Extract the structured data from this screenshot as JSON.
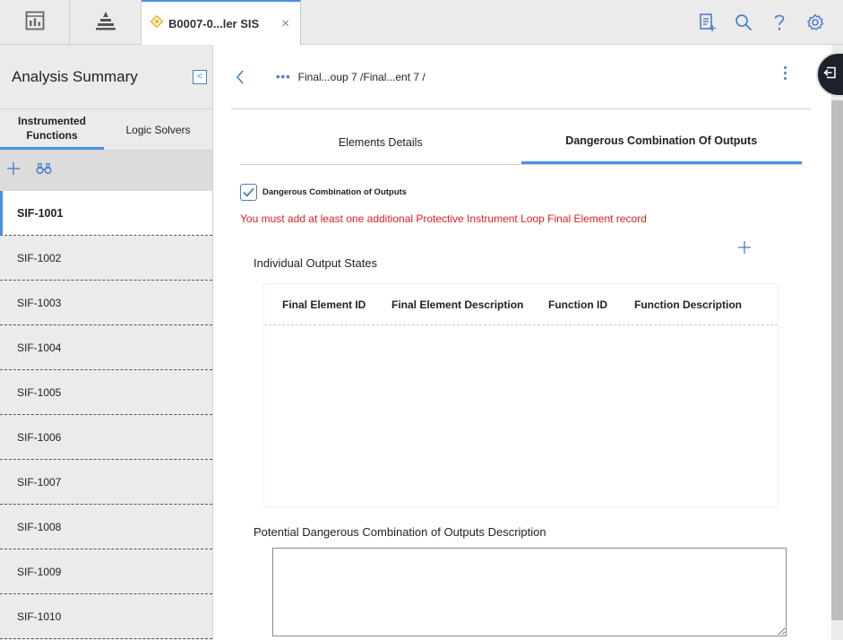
{
  "topbar": {
    "doc_tab_label": "B0007-0...ler SIS",
    "doc_tab_close": "×",
    "icons": [
      "dashboard-icon",
      "hierarchy-icon",
      "clipboard-add-icon",
      "search-icon",
      "help-icon",
      "gear-icon"
    ]
  },
  "left_panel": {
    "title": "Analysis Summary",
    "tabs": [
      {
        "label": "Instrumented Functions",
        "active": true
      },
      {
        "label": "Logic Solvers",
        "active": false
      }
    ],
    "toolbar": [
      "add-icon",
      "binoculars-icon"
    ],
    "items": [
      {
        "label": "SIF-1001",
        "active": true
      },
      {
        "label": "SIF-1002"
      },
      {
        "label": "SIF-1003"
      },
      {
        "label": "SIF-1004"
      },
      {
        "label": "SIF-1005"
      },
      {
        "label": "SIF-1006"
      },
      {
        "label": "SIF-1007"
      },
      {
        "label": "SIF-1008"
      },
      {
        "label": "SIF-1009"
      },
      {
        "label": "SIF-1010"
      }
    ]
  },
  "main": {
    "breadcrumb_dots": "•••",
    "breadcrumb": "Final...oup 7 /Final...ent 7 /",
    "tabs": [
      {
        "label": "Elements Details",
        "active": false
      },
      {
        "label": "Dangerous Combination Of Outputs",
        "active": true
      }
    ],
    "checkbox": {
      "label": "Dangerous Combination of Outputs",
      "checked": true
    },
    "error": "You must add at least one additional Protective Instrument Loop Final Element record",
    "states_title": "Individual Output States",
    "table_headers": [
      "Final Element ID",
      "Final Element Description",
      "Function ID",
      "Function Description"
    ],
    "potential_title": "Potential Dangerous Combination of Outputs Description",
    "description_value": ""
  },
  "colors": {
    "accent": "#4a90e2",
    "error": "#e02020",
    "tab_icon": "#f0b429"
  }
}
